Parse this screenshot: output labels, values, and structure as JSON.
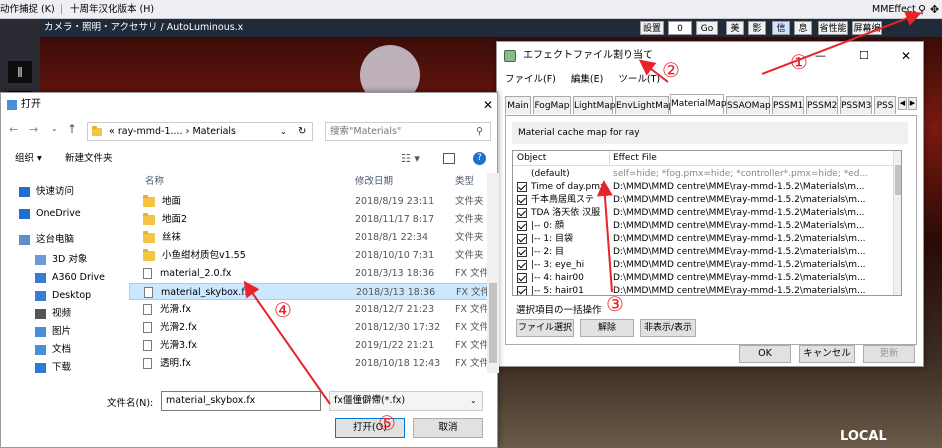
{
  "topbar": {
    "item1": "动作捕捉 (K)",
    "sep": "|",
    "item2": "十周年汉化版本 (H)",
    "mmeffect": "MMEffect"
  },
  "mme_bar": {
    "title": "カメラ・照明・アクセサリ / AutoLuminous.x",
    "btn_set": "設置",
    "field_value": "0",
    "btn_go": "Go",
    "btn_beauty": "美",
    "btn_shadow": "影",
    "btn_info": "信",
    "btn_shape": "息",
    "btn_save": "省性能",
    "btn_tool": "屏幕编"
  },
  "left_strip": {
    "tab1": "ǁ",
    "tab2": "▷",
    "tab3": "ǁ"
  },
  "effect_window": {
    "title": "エフェクトファイル割り当て",
    "menu": [
      "ファイル(F)",
      "編集(E)",
      "ツール(T)"
    ],
    "tabs": [
      "Main",
      "FogMap",
      "LightMap",
      "EnvLightMap",
      "MaterialMap",
      "SSAOMap",
      "PSSM1",
      "PSSM2",
      "PSSM3",
      "PSS"
    ],
    "description": "Material cache map for ray",
    "col_object": "Object",
    "col_effect": "Effect File",
    "rows": [
      {
        "object": "(default)",
        "effect": "self=hide; *fog.pmx=hide; *controller*.pmx=hide; *ed...",
        "checked": false,
        "indent": true
      },
      {
        "object": "Time of day.pmx",
        "effect": "D:\\MMD\\MMD centre\\MME\\ray-mmd-1.5.2\\Materials\\m...",
        "checked": true,
        "indent": false
      },
      {
        "object": "千本鳥居風ステ",
        "effect": "D:\\MMD\\MMD centre\\MME\\ray-mmd-1.5.2\\materials\\m...",
        "checked": true,
        "indent": false
      },
      {
        "object": "TDA 洛天依 汉服",
        "effect": "D:\\MMD\\MMD centre\\MME\\ray-mmd-1.5.2\\Materials\\m...",
        "checked": true,
        "indent": false
      },
      {
        "object": "|-- 0: 顔",
        "effect": "D:\\MMD\\MMD centre\\MME\\ray-mmd-1.5.2\\Materials\\m...",
        "checked": true,
        "indent": false
      },
      {
        "object": "|-- 1: 目袋",
        "effect": "D:\\MMD\\MMD centre\\MME\\ray-mmd-1.5.2\\materials\\m...",
        "checked": true,
        "indent": false
      },
      {
        "object": "|-- 2: 目",
        "effect": "D:\\MMD\\MMD centre\\MME\\ray-mmd-1.5.2\\materials\\m...",
        "checked": true,
        "indent": false
      },
      {
        "object": "|-- 3: eye_hi",
        "effect": "D:\\MMD\\MMD centre\\MME\\ray-mmd-1.5.2\\materials\\m...",
        "checked": true,
        "indent": false
      },
      {
        "object": "|-- 4: hair00",
        "effect": "D:\\MMD\\MMD centre\\MME\\ray-mmd-1.5.2\\materials\\m...",
        "checked": true,
        "indent": false
      },
      {
        "object": "|-- 5: hair01",
        "effect": "D:\\MMD\\MMD centre\\MME\\ray-mmd-1.5.2\\materials\\m...",
        "checked": true,
        "indent": false
      }
    ],
    "group_label": "選択項目の一括操作",
    "btn_file_select": "ファイル選択",
    "btn_remove": "解除",
    "btn_toggle": "非表示/表示",
    "btn_ok": "OK",
    "btn_cancel": "キャンセル",
    "btn_update": "更新"
  },
  "open_dialog": {
    "title": "打开",
    "breadcrumb_prefix": "«",
    "breadcrumb1": "ray-mmd-1....",
    "breadcrumb_sep": "›",
    "breadcrumb2": "Materials",
    "search_placeholder": "搜索\"Materials\"",
    "organize": "组织 ▾",
    "new_folder": "新建文件夹",
    "nav": [
      "快速访问",
      "OneDrive",
      "这台电脑",
      "3D 对象",
      "A360 Drive",
      "Desktop",
      "视频",
      "图片",
      "文档",
      "下载"
    ],
    "col_name": "名称",
    "col_date": "修改日期",
    "col_type": "类型",
    "files": [
      {
        "name": "地面",
        "date": "2018/8/19 23:11",
        "type": "文件夹",
        "kind": "folder"
      },
      {
        "name": "地面2",
        "date": "2018/11/17 8:17",
        "type": "文件夹",
        "kind": "folder"
      },
      {
        "name": "丝袜",
        "date": "2018/8/1 22:34",
        "type": "文件夹",
        "kind": "folder"
      },
      {
        "name": "小鱼绀材质包v1.55",
        "date": "2018/10/10 7:31",
        "type": "文件夹",
        "kind": "folder"
      },
      {
        "name": "material_2.0.fx",
        "date": "2018/3/13 18:36",
        "type": "FX 文件",
        "kind": "file"
      },
      {
        "name": "material_skybox.fx",
        "date": "2018/3/13 18:36",
        "type": "FX 文件",
        "kind": "file",
        "selected": true
      },
      {
        "name": "光滑.fx",
        "date": "2018/12/7 21:23",
        "type": "FX 文件",
        "kind": "file"
      },
      {
        "name": "光滑2.fx",
        "date": "2018/12/30 17:32",
        "type": "FX 文件",
        "kind": "file"
      },
      {
        "name": "光滑3.fx",
        "date": "2019/1/22 21:21",
        "type": "FX 文件",
        "kind": "file"
      },
      {
        "name": "透明.fx",
        "date": "2018/10/18 12:43",
        "type": "FX 文件",
        "kind": "file"
      }
    ],
    "filename_label": "文件名(N):",
    "filename_value": "material_skybox.fx",
    "filter_value": "fx僵僮僻僀(*.fx)",
    "btn_open": "打开(O)",
    "btn_cancel": "取消"
  },
  "annotations": {
    "n1": "①",
    "n2": "②",
    "n3": "③",
    "n4": "④",
    "n5": "⑤",
    "scene_text": "LOCAL"
  },
  "colors": {
    "arrow": "#e8242a",
    "selected_row": "#cce8ff",
    "mme_bar": "#202a38"
  }
}
